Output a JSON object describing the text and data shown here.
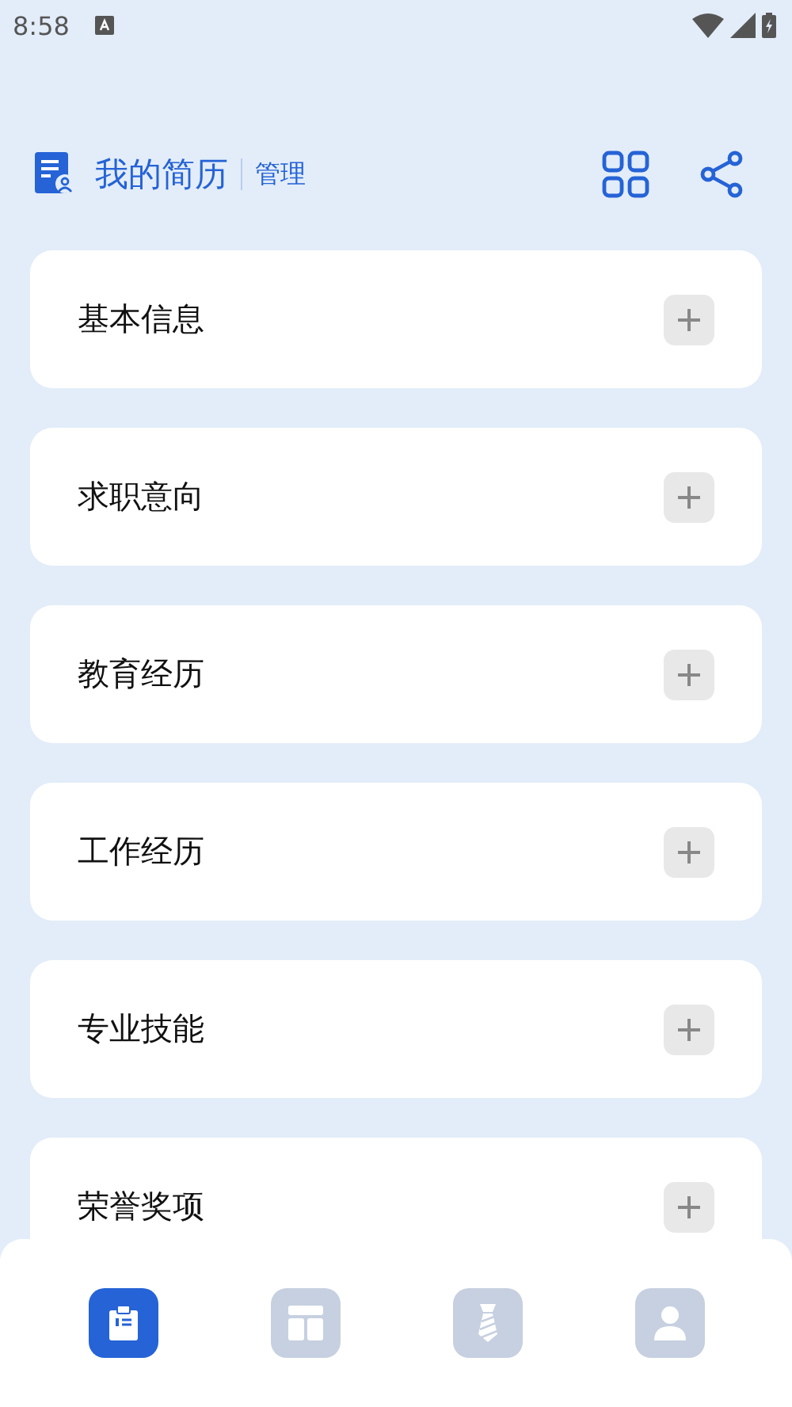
{
  "status_bar": {
    "time": "8:58"
  },
  "header": {
    "title": "我的简历",
    "action": "管理"
  },
  "sections": [
    {
      "label": "基本信息"
    },
    {
      "label": "求职意向"
    },
    {
      "label": "教育经历"
    },
    {
      "label": "工作经历"
    },
    {
      "label": "专业技能"
    },
    {
      "label": "荣誉奖项"
    }
  ],
  "tabs": [
    {
      "kind": "resume",
      "selected": true
    },
    {
      "kind": "template",
      "selected": false
    },
    {
      "kind": "job",
      "selected": false
    },
    {
      "kind": "profile",
      "selected": false
    }
  ]
}
